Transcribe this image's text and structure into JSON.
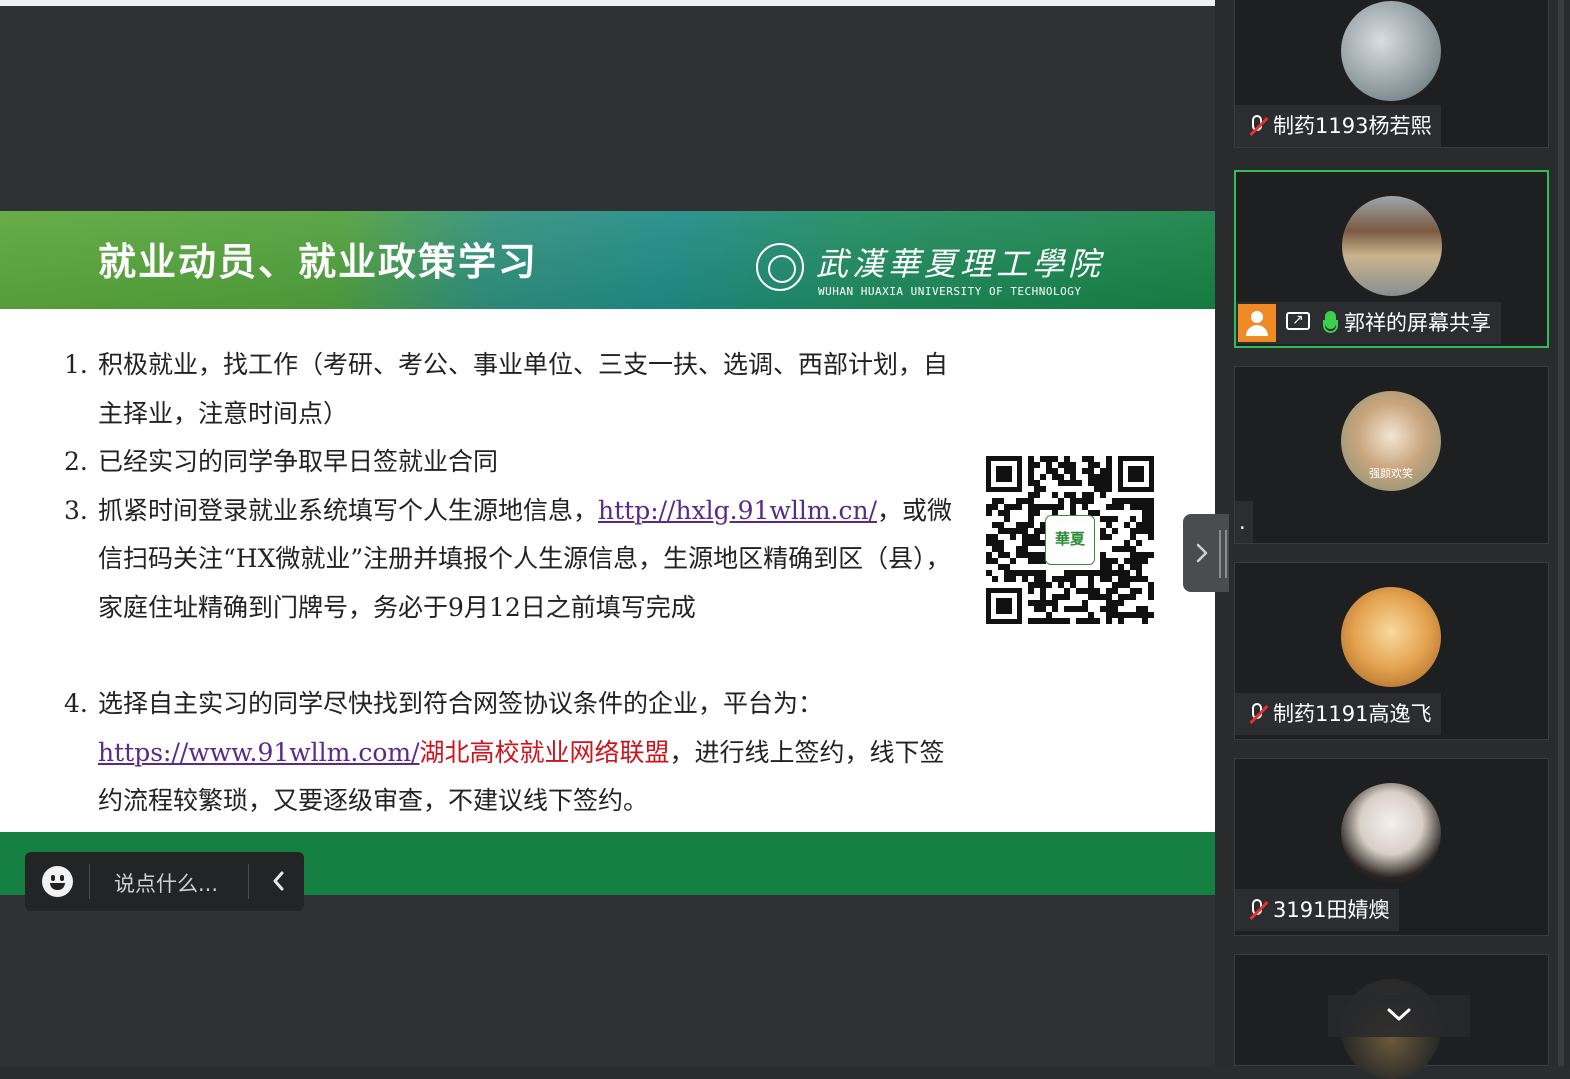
{
  "slide": {
    "title": "就业动员、就业政策学习",
    "logo_cn": "武漢華夏理工學院",
    "logo_en": "WUHAN HUAXIA UNIVERSITY OF TECHNOLOGY",
    "items": [
      {
        "num": "1.",
        "text": "积极就业，找工作（考研、考公、事业单位、三支一扶、选调、西部计划，自主择业，注意时间点）"
      },
      {
        "num": "2.",
        "text": "已经实习的同学争取早日签就业合同"
      },
      {
        "num": "3.",
        "text_a": "抓紧时间登录就业系统填写个人生源地信息，",
        "link": "http://hxlg.91wllm.cn/",
        "text_b": "，或微信扫码关注“HX微就业”注册并填报个人生源信息，生源地区精确到区（县），家庭住址精确到门牌号，务必于9月12日之前填写完成"
      },
      {
        "num": "4.",
        "text_a": "选择自主实习的同学尽快找到符合网签协议条件的企业，平台为：",
        "link": "https://www.91wllm.com/",
        "red": "湖北高校就业网络联盟",
        "text_b": "，进行线上签约，线下签约流程较繁琐，又要逐级审查，不建议线下签约。"
      }
    ],
    "qr_center": "華夏"
  },
  "chat": {
    "placeholder": "说点什么..."
  },
  "participants": [
    {
      "name": "制药1193杨若熙",
      "muted": true
    },
    {
      "name": "郭祥的屏幕共享",
      "muted": false,
      "active": true
    },
    {
      "name": ".",
      "avatar_caption": "强颜欢笑"
    },
    {
      "name": "制药1191高逸飞",
      "muted": true
    },
    {
      "name": "3191田婧燠",
      "muted": true
    }
  ],
  "colors": {
    "accent_green": "#168043",
    "active_border": "#2fbf5a",
    "link_purple": "#5a2a86",
    "red_text": "#d0121b"
  }
}
